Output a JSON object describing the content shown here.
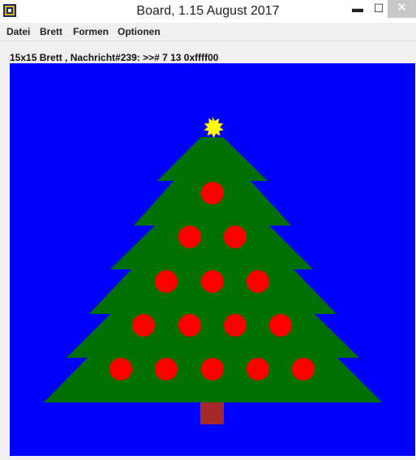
{
  "window": {
    "title": "Board, 1.15 August 2017",
    "minimize_glyph": "▬",
    "maximize_glyph": "☐",
    "close_glyph": "✕"
  },
  "menu": {
    "items": [
      "Datei",
      "Brett",
      "Formen",
      "Optionen"
    ]
  },
  "status": {
    "text": "15x15 Brett , Nachricht#239: >># 7 13 0xffff00"
  },
  "board": {
    "background": "#0000ff",
    "tree_color": "#007000",
    "ornament_color": "#ff0000",
    "trunk_color": "#a52a2a",
    "star_color": "#ffff00",
    "icons": [
      "star-icon",
      "tree",
      "ornaments",
      "trunk"
    ]
  }
}
